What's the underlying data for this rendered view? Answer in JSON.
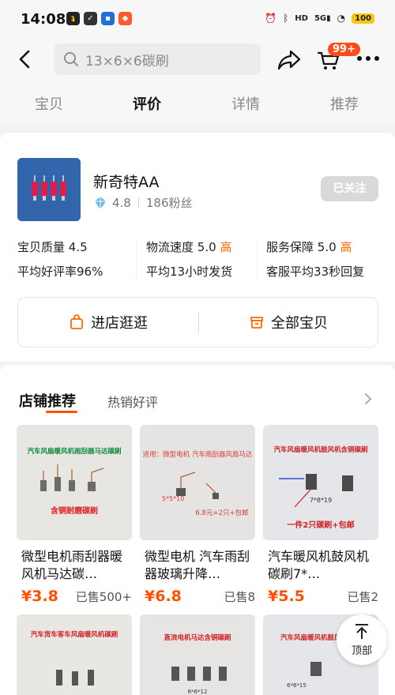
{
  "status_bar": {
    "time": "14:08",
    "network": "5G",
    "battery": "100"
  },
  "nav": {
    "search_placeholder": "13×6×6碳刷",
    "cart_badge": "99+"
  },
  "tabs": [
    {
      "label": "宝贝",
      "active": false
    },
    {
      "label": "评价",
      "active": true
    },
    {
      "label": "详情",
      "active": false
    },
    {
      "label": "推荐",
      "active": false
    }
  ],
  "shop": {
    "name": "新奇特AA",
    "rating": "4.8",
    "fans": "186粉丝",
    "follow_label": "已关注",
    "metrics": [
      {
        "label": "宝贝质量",
        "score": "4.5",
        "level": "",
        "detail": "平均好评率96%"
      },
      {
        "label": "物流速度",
        "score": "5.0",
        "level": "高",
        "detail": "平均13小时发货"
      },
      {
        "label": "服务保障",
        "score": "5.0",
        "level": "高",
        "detail": "客服平均33秒回复"
      }
    ],
    "enter_shop_label": "进店逛逛",
    "all_items_label": "全部宝贝"
  },
  "recommend": {
    "tab_active": "店铺推荐",
    "tab_other": "热销好评",
    "products": [
      {
        "img_title": "汽车风扇暖风机雨刮器马达碳刷",
        "img_sub": "含铜耐磨碳刷",
        "title": "微型电机雨刮器暖风机马达碳…",
        "price": "¥3.8",
        "sold": "已售500+"
      },
      {
        "img_title": "适用：微型电机 汽车雨刮器风扇马达",
        "img_sub": "6.8元=2只+包邮",
        "img_size": "5*5*10",
        "title": "微型电机 汽车雨刮器玻璃升降…",
        "price": "¥6.8",
        "sold": "已售8"
      },
      {
        "img_title": "汽车风扇暖风机鼓风机含铜碳刷",
        "img_sub": "一件2只碳刷+包邮",
        "img_size": "7*8*19",
        "title": "汽车暖风机鼓风机碳刷7*…",
        "price": "¥5.5",
        "sold": "已售2"
      }
    ],
    "row2_images": [
      {
        "img_title": "汽车货车客车风扇暖风机碳刷"
      },
      {
        "img_title": "直流电机马达含铜碳刷",
        "img_size": "6*6*12"
      },
      {
        "img_title": "汽车风扇暖风机鼓风机碳刷",
        "img_size": "6*6*15"
      }
    ]
  },
  "back_to_top": "顶部",
  "colors": {
    "accent": "#ff5000",
    "highlight": "#ff6a00"
  }
}
